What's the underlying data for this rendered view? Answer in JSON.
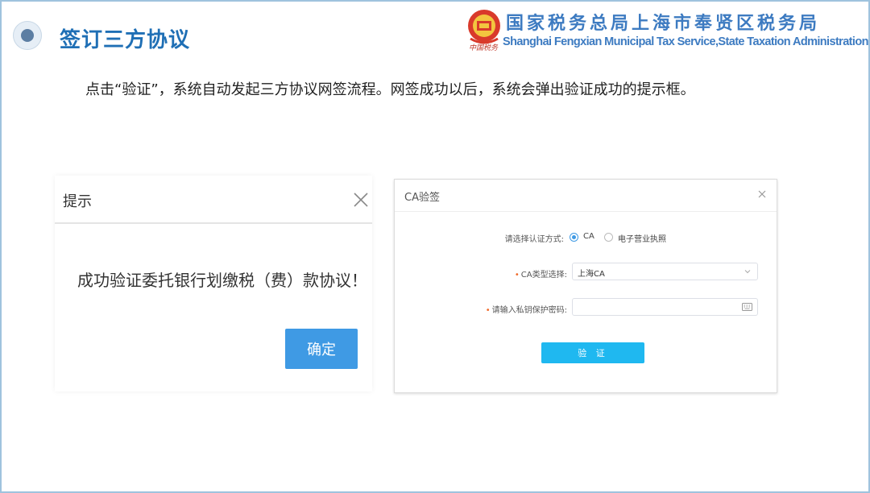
{
  "header": {
    "title": "签订三方协议",
    "org_cn": "国家税务总局上海市奉贤区税务局",
    "org_en": "Shanghai Fengxian Municipal Tax Service,State Taxation  Administration",
    "emblem_caption": "中国税务"
  },
  "instruction": "点击“验证”，系统自动发起三方协议网签流程。网签成功以后，系统会弹出验证成功的提示框。",
  "prompt_dialog": {
    "title": "提示",
    "message": "成功验证委托银行划缴税（费）款协议！",
    "ok_label": "确定"
  },
  "ca_dialog": {
    "title": "CA验签",
    "auth_method_label": "请选择认证方式:",
    "options": [
      "CA",
      "电子营业执照"
    ],
    "selected_option": "CA",
    "ca_type_label": "CA类型选择:",
    "ca_type_value": "上海CA",
    "password_label": "请输入私钥保护密码:",
    "password_value": "",
    "verify_label": "验 证"
  },
  "colors": {
    "title_blue": "#1f6fb5",
    "button_blue": "#3f9ae4",
    "verify_cyan": "#1fb8f0",
    "required_orange": "#f06a2a"
  }
}
